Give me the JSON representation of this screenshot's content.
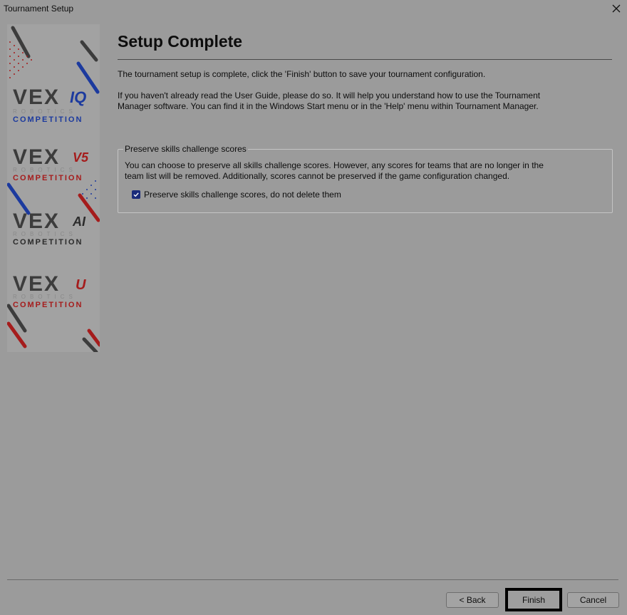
{
  "window": {
    "title": "Tournament Setup"
  },
  "sidebar": {
    "logos": [
      {
        "word": "VEX",
        "variant": "IQ",
        "robotics": "ROBOTICS",
        "competition": "COMPETITION",
        "variant_color": "#1c3a9e"
      },
      {
        "word": "VEX",
        "variant": "V5",
        "robotics": "ROBOTICS",
        "competition": "COMPETITION",
        "variant_color": "#a51c1c"
      },
      {
        "word": "VEX",
        "variant": "AI",
        "robotics": "ROBOTICS",
        "competition": "COMPETITION",
        "variant_color": "#2b2b2b"
      },
      {
        "word": "VEX",
        "variant": "U",
        "robotics": "ROBOTICS",
        "competition": "COMPETITION",
        "variant_color": "#a51c1c"
      }
    ]
  },
  "main": {
    "heading": "Setup Complete",
    "para1": "The tournament setup is complete, click the 'Finish' button to save your tournament configuration.",
    "para2": "If you haven't already read the User Guide, please do so.  It will help you understand how to use the Tournament Manager software.  You can find it in the Windows Start menu or in the 'Help' menu within Tournament Manager.",
    "group": {
      "legend": "Preserve skills challenge scores",
      "text": "You can choose to preserve all skills challenge scores. However, any scores for teams that are no longer in the team list will be removed. Additionally, scores cannot be preserved if the game configuration changed.",
      "checkbox_label": "Preserve skills challenge scores, do not delete them",
      "checkbox_checked": true
    }
  },
  "footer": {
    "back_label": "< Back",
    "finish_label": "Finish",
    "cancel_label": "Cancel"
  },
  "colors": {
    "background": "#9b9b9b",
    "accent_blue": "#1c3a9e",
    "accent_red": "#a51c1c"
  }
}
